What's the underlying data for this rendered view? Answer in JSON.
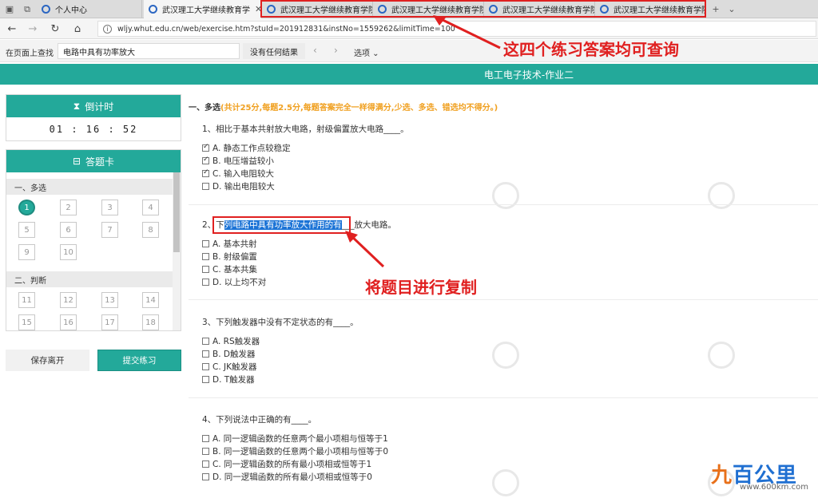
{
  "browser": {
    "tabs": [
      {
        "label": "个人中心",
        "active": false
      },
      {
        "label": "武汉理工大学继续教育学",
        "active": true
      },
      {
        "label": "武汉理工大学继续教育学院",
        "active": false
      },
      {
        "label": "武汉理工大学继续教育学院",
        "active": false
      },
      {
        "label": "武汉理工大学继续教育学院",
        "active": false
      },
      {
        "label": "武汉理工大学继续教育学院",
        "active": false
      }
    ],
    "url": "wljy.whut.edu.cn/web/exercise.htm?stuId=201912831&instNo=1559262&limitTime=100",
    "find": {
      "label": "在页面上查找",
      "value": "电路中具有功率放大",
      "result": "没有任何结果",
      "options": "选项"
    }
  },
  "annotations": {
    "tabs_note": "这四个练习答案均可查询",
    "copy_note": "将题目进行复制"
  },
  "page": {
    "title": "电工电子技术-作业二",
    "timer_label": "倒计时",
    "timer_value": "01 : 16 : 52",
    "card_label": "答题卡",
    "sections": [
      {
        "label": "一、多选",
        "numbers": [
          "1",
          "2",
          "3",
          "4",
          "5",
          "6",
          "7",
          "8",
          "9",
          "10"
        ],
        "answered": [
          "1"
        ]
      },
      {
        "label": "二、判断",
        "numbers": [
          "11",
          "12",
          "13",
          "14",
          "15",
          "16",
          "17",
          "18"
        ],
        "answered": []
      }
    ],
    "save_button": "保存离开",
    "submit_button": "提交练习",
    "section_title": "一、多选",
    "section_note": "(共计25分,每题2.5分,每题答案完全一样得满分,少选、多选、错选均不得分。)",
    "questions": [
      {
        "text": "1、相比于基本共射放大电路，射级偏置放大电路____。",
        "options": [
          {
            "label": "A. 静态工作点较稳定",
            "checked": true
          },
          {
            "label": "B. 电压增益较小",
            "checked": true
          },
          {
            "label": "C. 输入电阻较大",
            "checked": true
          },
          {
            "label": "D. 输出电阻较大",
            "checked": false
          }
        ]
      },
      {
        "text_pre": "2、下",
        "text_sel": "列电路中具有功率放大作用的有",
        "text_post": "___放大电路。",
        "options": [
          {
            "label": "A. 基本共射",
            "checked": false
          },
          {
            "label": "B. 射级偏置",
            "checked": false
          },
          {
            "label": "C. 基本共集",
            "checked": false
          },
          {
            "label": "D. 以上均不对",
            "checked": false
          }
        ]
      },
      {
        "text": "3、下列触发器中没有不定状态的有____。",
        "options": [
          {
            "label": "A. RS触发器",
            "checked": false
          },
          {
            "label": "B. D触发器",
            "checked": false
          },
          {
            "label": "C. JK触发器",
            "checked": false
          },
          {
            "label": "D. T触发器",
            "checked": false
          }
        ]
      },
      {
        "text": "4、下列说法中正确的有____。",
        "options": [
          {
            "label": "A. 同一逻辑函数的任意两个最小项相与恒等于1",
            "checked": false
          },
          {
            "label": "B. 同一逻辑函数的任意两个最小项相与恒等于0",
            "checked": false
          },
          {
            "label": "C. 同一逻辑函数的所有最小项相或恒等于1",
            "checked": false
          },
          {
            "label": "D. 同一逻辑函数的所有最小项相或恒等于0",
            "checked": false
          }
        ]
      }
    ]
  },
  "logo": {
    "mark_part1": "九",
    "mark_part2": "百公里",
    "url": "www.600km.com"
  },
  "colors": {
    "accent": "#23a99a",
    "annotation": "#e02020",
    "selection": "#1b73d6"
  }
}
